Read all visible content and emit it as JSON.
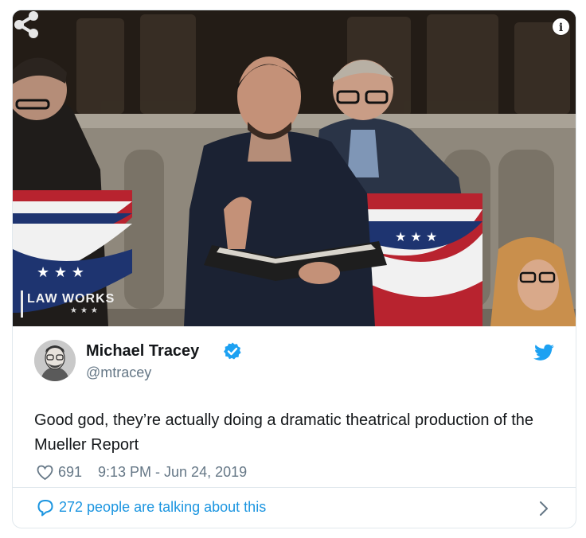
{
  "media": {
    "watermark_text": "LAW WORKS",
    "watermark_stars": "★★★",
    "info_glyph": "i",
    "icons": [
      "info-icon",
      "share-icon"
    ]
  },
  "tweet": {
    "display_name": "Michael Tracey",
    "handle": "@mtracey",
    "text": "Good god, they’re actually doing a dramatic theatrical production of the Mueller Report",
    "like_count": "691",
    "timestamp": "9:13 PM - Jun 24, 2019",
    "icons": [
      "verified-icon",
      "twitter-bird-icon",
      "heart-icon"
    ]
  },
  "footer": {
    "talking_label": "272 people are talking about this",
    "icons": [
      "comment-bubble-icon",
      "chevron-right-icon"
    ]
  },
  "colors": {
    "accent": "#1da1f2",
    "link": "#1b95e0",
    "secondary_text": "#657786",
    "border": "#e1e8ed"
  }
}
